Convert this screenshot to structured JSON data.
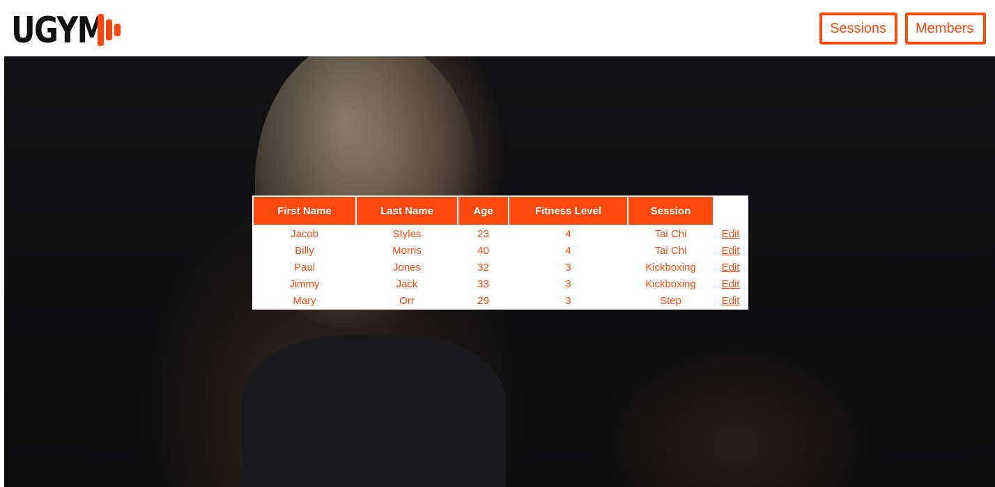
{
  "brand": {
    "logo_text": "UGYM",
    "accent": "#fc4a0f"
  },
  "nav": {
    "sessions": "Sessions",
    "members": "Members"
  },
  "table": {
    "headers": [
      "First Name",
      "Last Name",
      "Age",
      "Fitness Level",
      "Session"
    ],
    "edit_label": "Edit",
    "rows": [
      [
        "Jacob",
        "Styles",
        "23",
        "4",
        "Tai Chi"
      ],
      [
        "Billy",
        "Morris",
        "40",
        "4",
        "Tai Chi"
      ],
      [
        "Paul",
        "Jones",
        "32",
        "3",
        "Kickboxing"
      ],
      [
        "Jimmy",
        "Jack",
        "33",
        "3",
        "Kickboxing"
      ],
      [
        "Mary",
        "Orr",
        "29",
        "3",
        "Step"
      ]
    ]
  }
}
